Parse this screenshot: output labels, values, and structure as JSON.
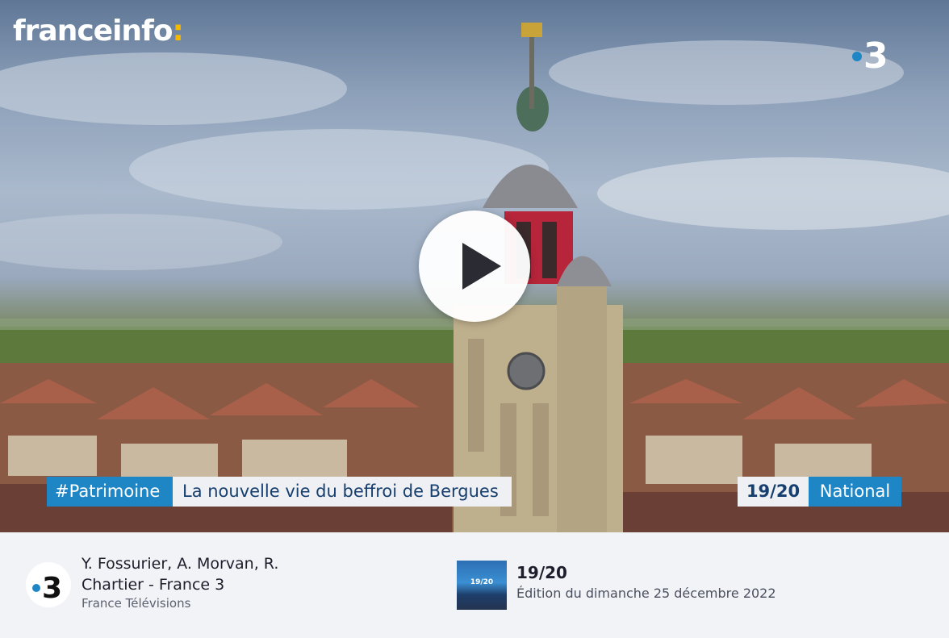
{
  "player": {
    "brand_name": "franceinfo",
    "brand_colon": ":",
    "channel_logo_digit": "3",
    "play_icon": "play-icon",
    "banner": {
      "hashtag": "#Patrimoine",
      "headline": "La nouvelle vie du beffroi de Bergues",
      "program": "19/20",
      "edition_scope": "National"
    }
  },
  "info": {
    "channel_digit": "3",
    "credits": "Y. Fossurier, A. Morvan, R. Chartier - France 3",
    "publisher": "France Télévisions",
    "show": {
      "thumb_label": "19/20",
      "title": "19/20",
      "edition": "Édition du dimanche 25 décembre 2022"
    }
  },
  "colors": {
    "accent_blue": "#1f86c6",
    "brand_yellow": "#f6b900",
    "headline_text": "#163f70",
    "info_bg": "#f2f3f7"
  }
}
